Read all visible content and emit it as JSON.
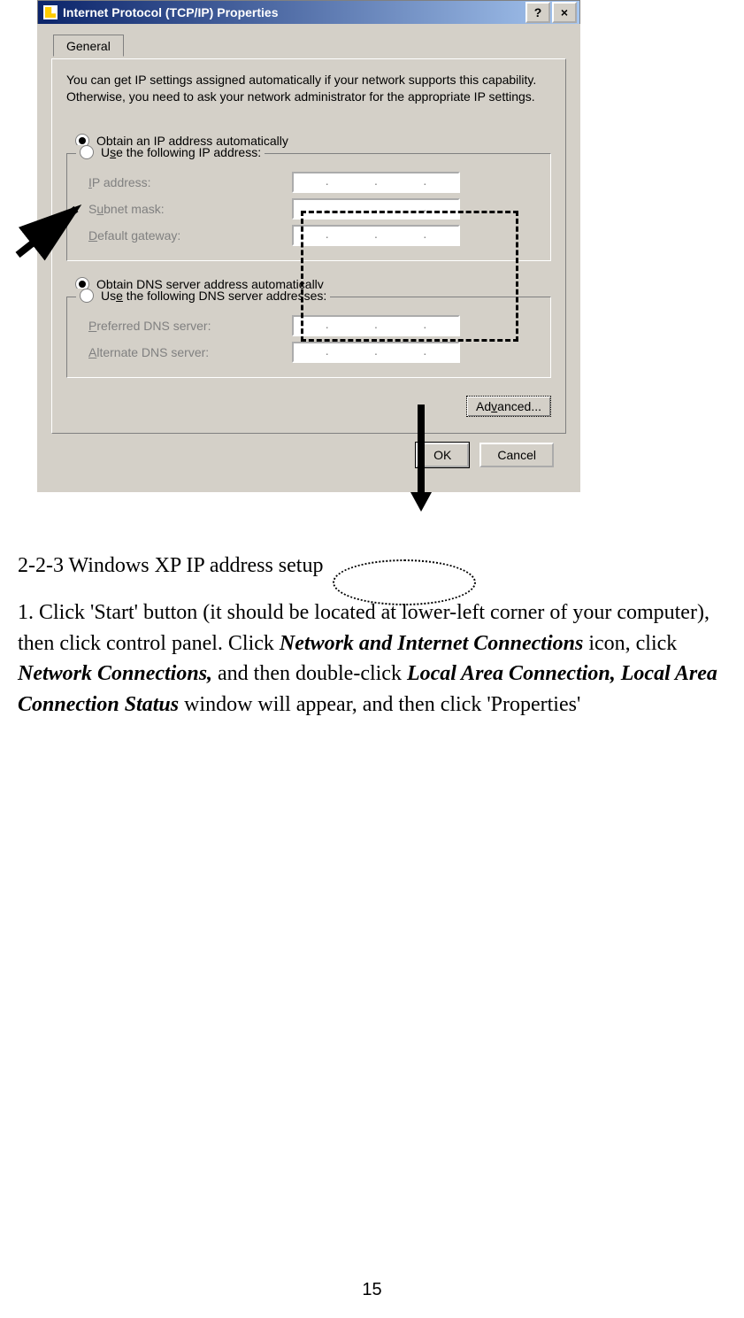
{
  "dialog": {
    "title": "Internet Protocol (TCP/IP) Properties",
    "help_glyph": "?",
    "close_glyph": "×",
    "tab": "General",
    "description": "You can get IP settings assigned automatically if your network supports this capability. Otherwise, you need to ask your network administrator for the appropriate IP settings.",
    "radio_auto_ip_pre": "",
    "radio_auto_ip_u": "O",
    "radio_auto_ip_post": "btain an IP address automatically",
    "radio_use_ip_pre": "U",
    "radio_use_ip_u": "s",
    "radio_use_ip_post": "e the following IP address:",
    "ip_label_pre": "",
    "ip_label_u": "I",
    "ip_label_post": "P address:",
    "subnet_label_pre": "S",
    "subnet_label_u": "u",
    "subnet_label_post": "bnet mask:",
    "gateway_label_pre": "",
    "gateway_label_u": "D",
    "gateway_label_post": "efault gateway:",
    "radio_auto_dns_pre": "O",
    "radio_auto_dns_u": "b",
    "radio_auto_dns_post": "tain DNS server address automatically",
    "radio_use_dns_pre": "Us",
    "radio_use_dns_u": "e",
    "radio_use_dns_post": " the following DNS server addresses:",
    "pref_dns_pre": "",
    "pref_dns_u": "P",
    "pref_dns_post": "referred DNS server:",
    "alt_dns_pre": "",
    "alt_dns_u": "A",
    "alt_dns_post": "lternate DNS server:",
    "advanced_pre": "Ad",
    "advanced_u": "v",
    "advanced_post": "anced...",
    "ok": "OK",
    "cancel": "Cancel",
    "dot": "."
  },
  "body": {
    "heading": "2-2-3 Windows XP IP address setup",
    "p1a": "1. Click 'Start' button (it should be located at lower-left corner of your computer), then click control panel. Click ",
    "p1b": "Network and Internet Connections",
    "p1c": " icon, click ",
    "p1d": "Network Connections,",
    "p1e": " and then double-click ",
    "p1f": "Local Area Connection, Local Area Connection Status",
    "p1g": " window will appear, and then click 'Properties'"
  },
  "page_number": "15"
}
